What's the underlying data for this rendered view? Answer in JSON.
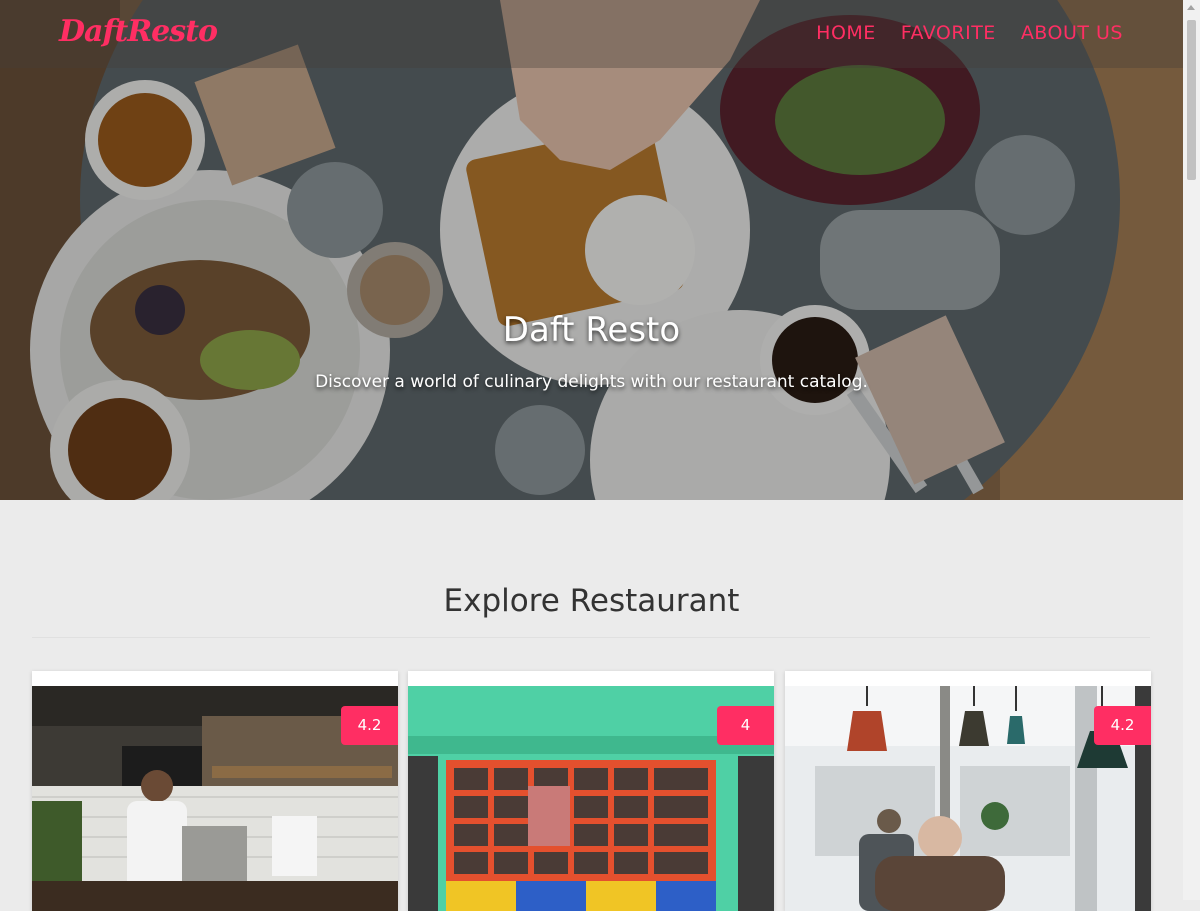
{
  "nav": {
    "brand": "DaftResto",
    "links": [
      "HOME",
      "FAVORITE",
      "ABOUT US"
    ]
  },
  "hero": {
    "title": "Daft Resto",
    "tagline": "Discover a world of culinary delights with our restaurant catalog."
  },
  "explore": {
    "title": "Explore Restaurant",
    "restaurants": [
      {
        "rating": "4.2"
      },
      {
        "rating": "4"
      },
      {
        "rating": "4.2"
      }
    ]
  },
  "colors": {
    "accent": "#ff2e63",
    "background": "#ebebeb"
  }
}
